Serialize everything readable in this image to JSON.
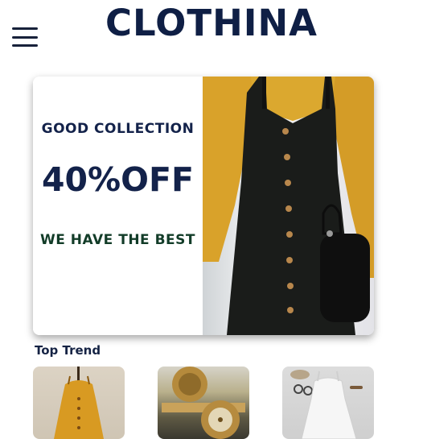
{
  "header": {
    "brand": "CLOTHINA",
    "menu_icon": "hamburger-menu-icon"
  },
  "banner": {
    "kicker": "GOOD COLLECTION",
    "offer": "40%OFF",
    "tagline": "WE HAVE THE BEST",
    "image": "woman-black-button-pinafore-dress-photo"
  },
  "top_trend": {
    "title": "Top Trend",
    "items": [
      {
        "image": "yellow-button-dress-photo"
      },
      {
        "image": "gold-watch-photo"
      },
      {
        "image": "white-dress-flatlay-photo"
      }
    ]
  },
  "colors": {
    "brand_navy": "#0f1f45",
    "tagline_green": "#123c28",
    "mustard": "#d9a22a",
    "dress_black": "#1a1c1a"
  }
}
